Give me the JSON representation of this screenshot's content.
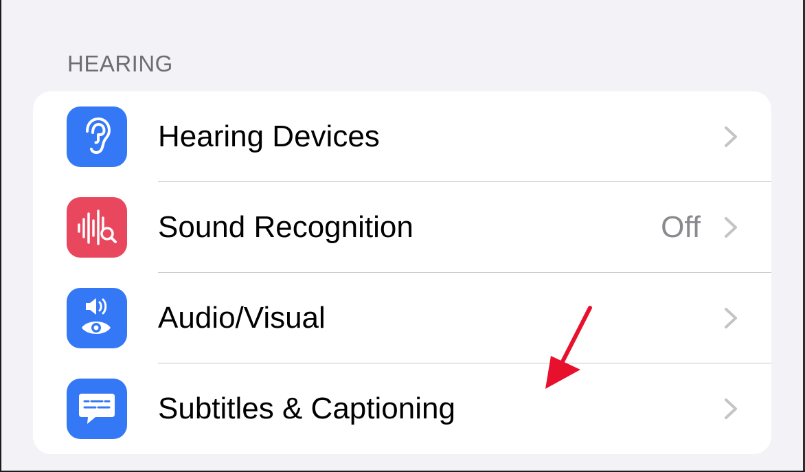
{
  "section": {
    "header": "HEARING"
  },
  "rows": [
    {
      "label": "Hearing Devices",
      "value": "",
      "icon": "ear-icon",
      "icon_color": "#3478f6"
    },
    {
      "label": "Sound Recognition",
      "value": "Off",
      "icon": "sound-recognition-icon",
      "icon_color": "#e8475e"
    },
    {
      "label": "Audio/Visual",
      "value": "",
      "icon": "speaker-eye-icon",
      "icon_color": "#3478f6"
    },
    {
      "label": "Subtitles & Captioning",
      "value": "",
      "icon": "captions-bubble-icon",
      "icon_color": "#3478f6"
    }
  ],
  "colors": {
    "background": "#f2f2f7",
    "group_background": "#ffffff",
    "section_header": "#6d6d72",
    "secondary_value": "#8a8a8e",
    "chevron": "#c4c4c7",
    "separator": "#c6c6c8",
    "annotation_arrow": "#e8112d"
  }
}
